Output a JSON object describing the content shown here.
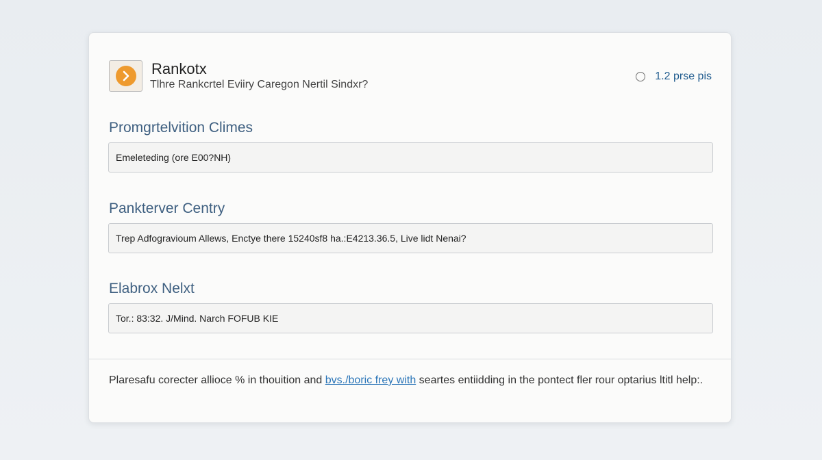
{
  "header": {
    "title": "Rankotx",
    "subtitle": "Tlhre Rankcrtel Eviiry Caregon Nertil Sindxr?",
    "logo_icon": "chevron-right-icon",
    "status_text": "1.2 prse pis"
  },
  "fields": [
    {
      "label": "Promgrtelvition Climes",
      "value": "Emeleteding (ore E00?NH)"
    },
    {
      "label": "Pankterver Centry",
      "value": "Trep Adfogravioum Allews, Enctye there 15240sf8 ha.:E4213.36.5, Live lidt Nenai?"
    },
    {
      "label": "Elabrox Nelxt",
      "value": "Tor.: 83:32. J/Mind. Narch FOFUB KIE"
    }
  ],
  "footer": {
    "text_before": "Plaresafu corecter allioce % in thouition and ",
    "link_text": "bvs./boric frey with",
    "text_after": " seartes entiidding in the pontect fler rour optarius ltitl help:."
  },
  "colors": {
    "accent": "#ee9a2e",
    "label": "#3e5f80",
    "link": "#2a75b8"
  }
}
